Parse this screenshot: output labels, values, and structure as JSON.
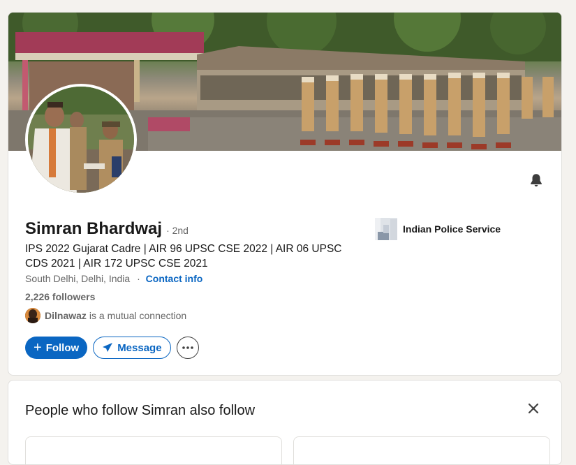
{
  "profile": {
    "name": "Simran Bhardwaj",
    "degree": "· 2nd",
    "headline": "IPS 2022 Gujarat Cadre | AIR 96 UPSC CSE 2022 | AIR 06 UPSC CDS 2021 | AIR 172 UPSC CSE 2021",
    "location": "South Delhi, Delhi, India",
    "location_separator": "·",
    "contact_label": "Contact info",
    "followers": "2,226 followers",
    "mutual_name": "Dilnawaz",
    "mutual_text": "is a mutual connection",
    "organization": "Indian Police Service"
  },
  "actions": {
    "follow_label": "Follow",
    "message_label": "Message",
    "more_label": "More actions"
  },
  "icons": {
    "bell": "bell-icon",
    "plus": "plus-icon",
    "send": "paper-plane-icon",
    "more": "ellipsis-icon",
    "close": "close-icon"
  },
  "also_follow": {
    "title": "People who follow Simran also follow"
  },
  "colors": {
    "accent": "#0a66c2",
    "background": "#f4f2ee",
    "card": "#ffffff",
    "text_muted": "#666666"
  }
}
